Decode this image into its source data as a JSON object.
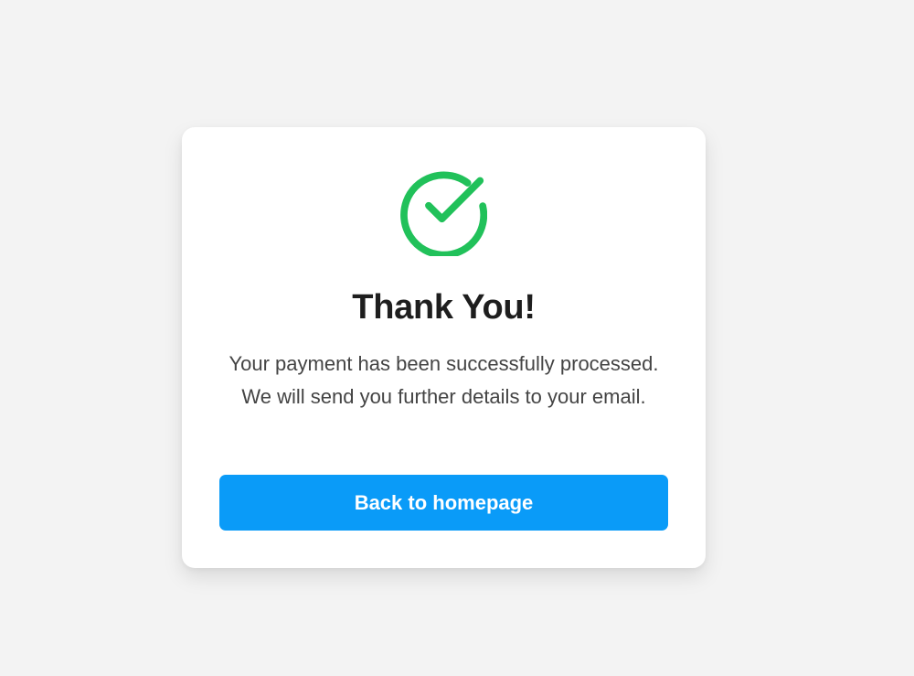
{
  "card": {
    "icon": "check-circle-icon",
    "title": "Thank You!",
    "message": "Your payment has been successfully processed. We will send you further details to your email.",
    "button_label": "Back to homepage"
  },
  "colors": {
    "background": "#f3f3f3",
    "card": "#ffffff",
    "success": "#21c15a",
    "button": "#0a9bf8",
    "title": "#1e1e1e",
    "text": "#444444"
  }
}
